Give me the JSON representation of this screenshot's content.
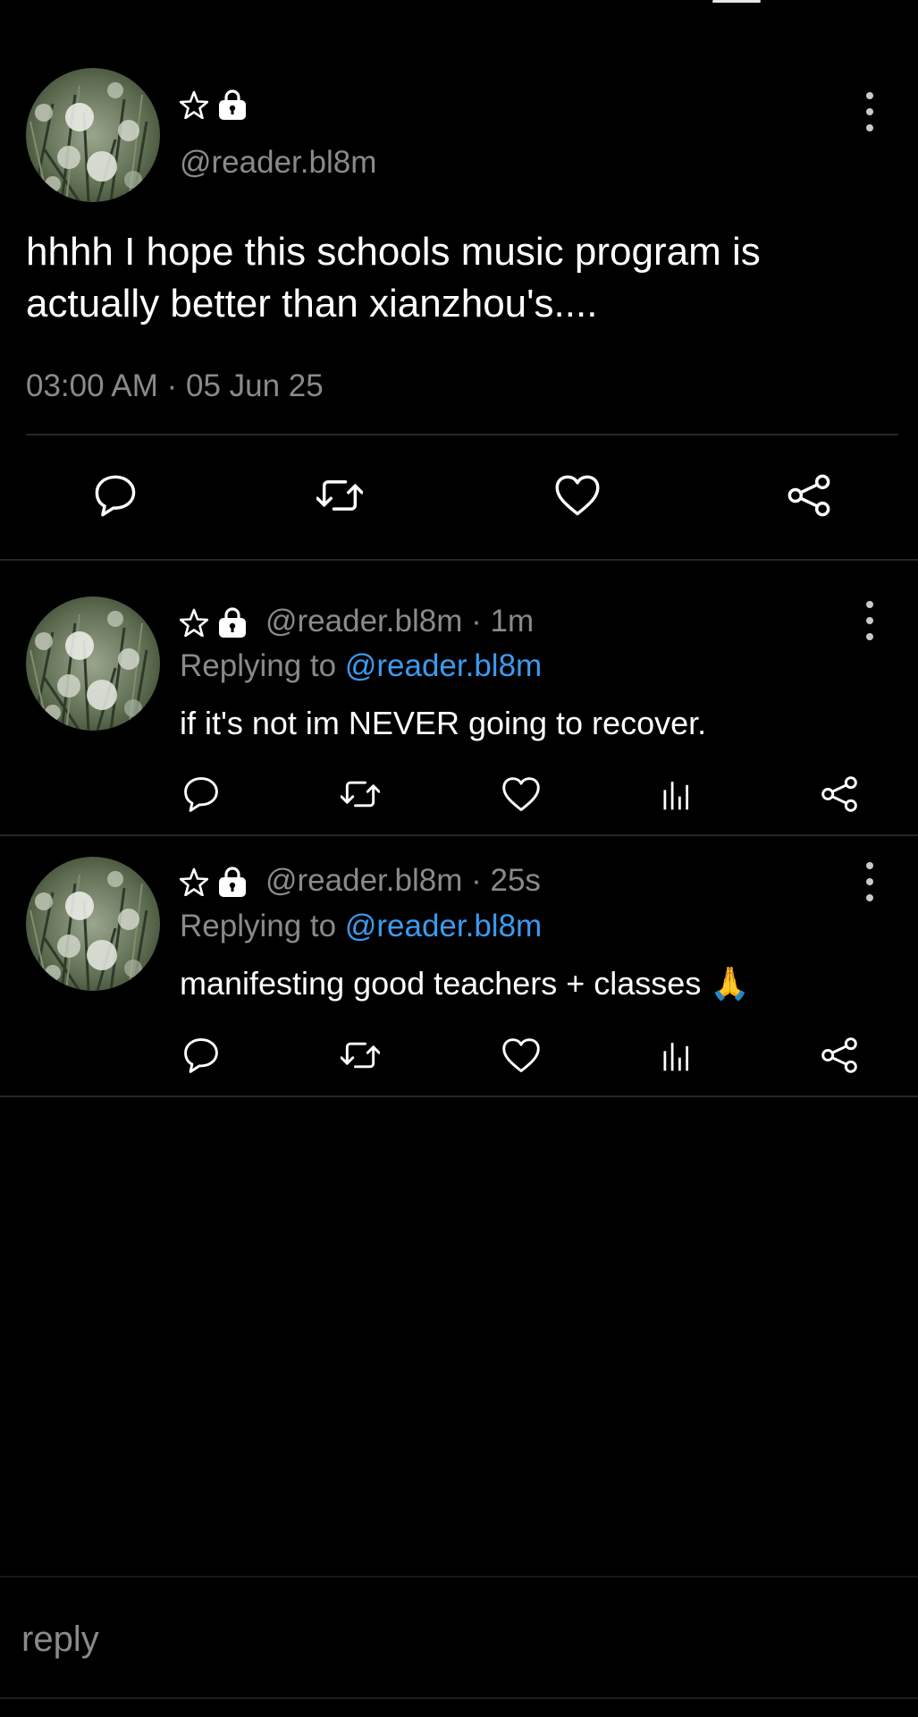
{
  "main_post": {
    "badges": [
      "star-icon",
      "lock-icon"
    ],
    "handle": "@reader.bl8m",
    "text": "hhhh I hope this schools music program is actually better than xianzhou's....",
    "timestamp": "03:00 AM · 05 Jun 25",
    "actions": [
      "comment-icon",
      "repost-icon",
      "like-icon",
      "share-icon"
    ]
  },
  "replies": [
    {
      "handle": "@reader.bl8m",
      "separator": "·",
      "time": "1m",
      "replying_prefix": "Replying to",
      "replying_handle": "@reader.bl8m",
      "text": "if it's not im NEVER going to recover."
    },
    {
      "handle": "@reader.bl8m",
      "separator": "·",
      "time": "25s",
      "replying_prefix": "Replying to",
      "replying_handle": "@reader.bl8m",
      "text": "manifesting good teachers + classes 🙏"
    }
  ],
  "reply_actions": [
    "comment-icon",
    "repost-icon",
    "like-icon",
    "stats-icon",
    "share-icon"
  ],
  "composer": {
    "placeholder": "reply"
  },
  "colors": {
    "background": "#000000",
    "text": "#ffffff",
    "muted": "#8a8a8a",
    "link": "#3b9bf0",
    "divider": "#262626"
  }
}
